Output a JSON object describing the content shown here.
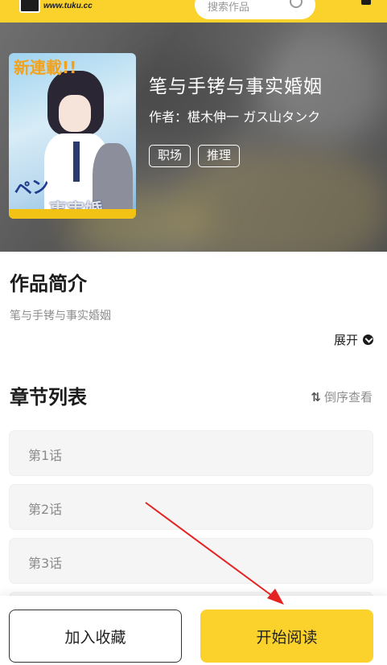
{
  "topbar": {
    "logo_url": "www.tuku.cc",
    "search_placeholder": "搜索作品"
  },
  "comic": {
    "title": "笔与手铐与事实婚姻",
    "author": "作者：椹木伸一 ガス山タンク",
    "tags": [
      "职场",
      "推理"
    ],
    "cover_text": {
      "banner": "新連載!!",
      "line1": "ペン",
      "line2": "事実婚"
    }
  },
  "intro": {
    "heading": "作品简介",
    "text": "笔与手铐与事实婚姻",
    "expand_label": "展开"
  },
  "chapters": {
    "heading": "章节列表",
    "reverse_label": "倒序查看",
    "items": [
      "第1话",
      "第2话",
      "第3话"
    ]
  },
  "actions": {
    "favorite_label": "加入收藏",
    "read_label": "开始阅读"
  },
  "colors": {
    "accent": "#fbd22c",
    "annotation": "#e52222"
  }
}
